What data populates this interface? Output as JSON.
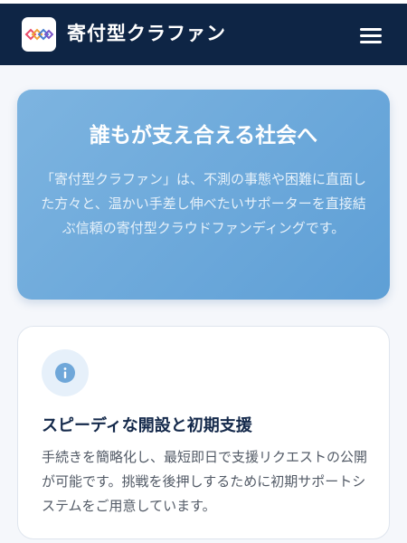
{
  "header": {
    "brand": "寄付型クラファン",
    "logo_icon": "interlocking-rings-logo",
    "menu_icon": "hamburger-menu-icon",
    "background": "#0e2545"
  },
  "hero": {
    "title": "誰もが支え合える社会へ",
    "text": "「寄付型クラファン」は、不測の事態や困難に直面した方々と、温かい手差し伸べたいサポーターを直接結ぶ信頼の寄付型クラウドファンディングです。",
    "gradient": [
      "#7db4e0",
      "#5e9fd6"
    ]
  },
  "feature": {
    "icon": "info-icon",
    "title": "スピーディな開設と初期支援",
    "text": "手続きを簡略化し、最短即日で支援リクエストの公開が可能です。挑戦を後押しするために初期サポートシステムをご用意しています。"
  }
}
